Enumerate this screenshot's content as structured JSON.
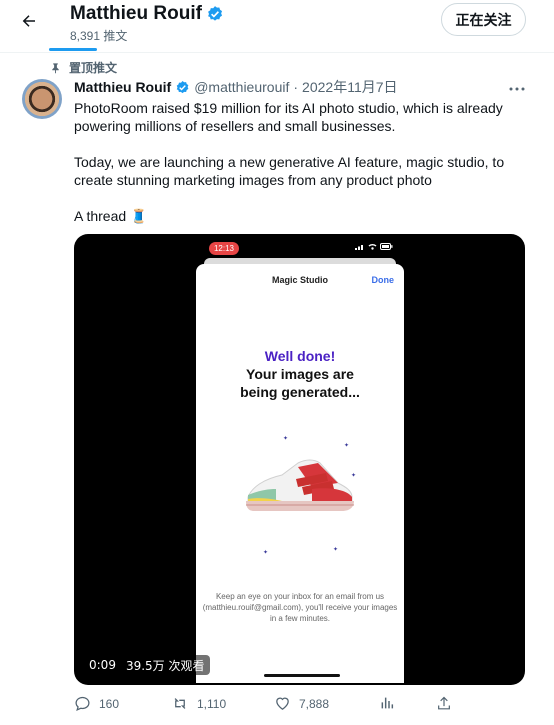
{
  "header": {
    "title": "Matthieu Rouif",
    "post_count": "8,391 推文",
    "follow_label": "正在关注",
    "icons": [
      "back-arrow-icon",
      "verified-badge-icon"
    ]
  },
  "pinned": {
    "label": "置顶推文",
    "icon": "pin-icon"
  },
  "tweet": {
    "author_name": "Matthieu Rouif",
    "handle": "@matthieurouif",
    "separator": "·",
    "date": "2022年11月7日",
    "lines": [
      "PhotoRoom raised $19 million for its AI photo studio, which is already",
      "powering millions of resellers and small businesses.",
      "Today, we are launching  a new generative AI feature, magic studio, to",
      "create stunning marketing images from any product photo",
      "A thread"
    ],
    "thread_emoji": "🧵"
  },
  "media": {
    "status_time": "12:13",
    "sheet_title": "Magic Studio",
    "sheet_done": "Done",
    "done_title": "Well done!",
    "done_line2": "Your images are",
    "done_line3": "being generated...",
    "footer_text": "Keep an eye on your inbox for an email from us (matthieu.rouif@gmail.com), you'll receive your images in a few minutes.",
    "video_time": "0:09",
    "view_count": "39.5万 次观看"
  },
  "actions": {
    "replies": "160",
    "retweets": "1,110",
    "likes": "7,888"
  },
  "colors": {
    "accent": "#1d9bf0",
    "text": "#0f1419",
    "muted": "#536471",
    "brand_purple": "#4b22c4"
  }
}
